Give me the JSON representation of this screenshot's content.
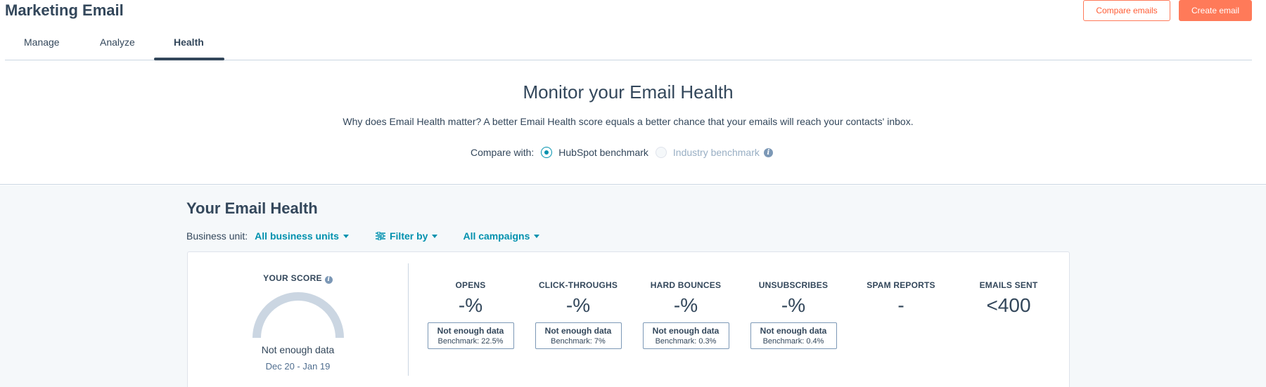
{
  "header": {
    "title": "Marketing Email",
    "compare_label": "Compare emails",
    "create_label": "Create email"
  },
  "tabs": [
    {
      "label": "Manage",
      "active": false
    },
    {
      "label": "Analyze",
      "active": false
    },
    {
      "label": "Health",
      "active": true
    }
  ],
  "hero": {
    "title": "Monitor your Email Health",
    "description": "Why does Email Health matter? A better Email Health score equals a better chance that your emails will reach your contacts' inbox.",
    "compare_label": "Compare with:",
    "options": [
      {
        "label": "HubSpot benchmark",
        "selected": true
      },
      {
        "label": "Industry benchmark",
        "selected": false,
        "disabled": true
      }
    ]
  },
  "health": {
    "title": "Your Email Health",
    "business_unit_label": "Business unit:",
    "business_unit_value": "All business units",
    "filter_label": "Filter by",
    "campaigns_label": "All campaigns",
    "score": {
      "label": "YOUR SCORE",
      "status": "Not enough data",
      "range": "Dec 20 - Jan 19"
    },
    "metrics": [
      {
        "name": "OPENS",
        "value": "-%",
        "box_status": "Not enough data",
        "benchmark": "Benchmark: 22.5%"
      },
      {
        "name": "CLICK-THROUGHS",
        "value": "-%",
        "box_status": "Not enough data",
        "benchmark": "Benchmark: 7%"
      },
      {
        "name": "HARD BOUNCES",
        "value": "-%",
        "box_status": "Not enough data",
        "benchmark": "Benchmark: 0.3%"
      },
      {
        "name": "UNSUBSCRIBES",
        "value": "-%",
        "box_status": "Not enough data",
        "benchmark": "Benchmark: 0.4%"
      },
      {
        "name": "SPAM REPORTS",
        "value": "-"
      },
      {
        "name": "EMAILS SENT",
        "value": "<400"
      }
    ]
  },
  "colors": {
    "accent": "#ff7a59",
    "link": "#0091ae",
    "text": "#33475b",
    "gauge": "#cbd6e2"
  }
}
